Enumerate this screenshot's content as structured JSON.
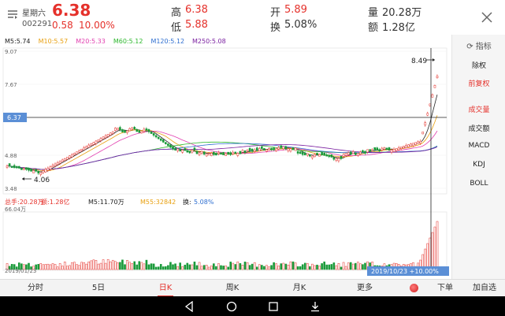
{
  "header": {
    "weekday": "星期六",
    "code": "002291",
    "price": "6.38",
    "change": "0.58",
    "change_pct": "10.00%",
    "high_label": "高",
    "high_value": "6.38",
    "low_label": "低",
    "low_value": "5.88",
    "open_label": "开",
    "open_value": "5.89",
    "turnover_label": "换",
    "turnover_value": "5.08%",
    "volume_label": "量",
    "volume_value": "20.28万",
    "amount_label": "额",
    "amount_value": "1.28亿"
  },
  "ma_legend": [
    {
      "text": "M5:5.74",
      "color": "#222222"
    },
    {
      "text": "M10:5.57",
      "color": "#e8a010"
    },
    {
      "text": "M20:5.33",
      "color": "#e23fb0"
    },
    {
      "text": "M60:5.12",
      "color": "#2eb82e"
    },
    {
      "text": "M120:5.12",
      "color": "#2f6fd0"
    },
    {
      "text": "M250:5.08",
      "color": "#7a1fa0"
    }
  ],
  "price_axis": {
    "top": "9.07",
    "second": "7.67",
    "mid": "6.37",
    "fourth": "4.88",
    "bottom": "3.48"
  },
  "annotations": {
    "high_label": "8.49",
    "low_label": "4.06"
  },
  "volume_legend": [
    {
      "text": "总手:20.28万",
      "color": "#e5312b"
    },
    {
      "text": "额:1.28亿",
      "color": "#e5312b"
    },
    {
      "text": "M5:11.70万",
      "color": "#222222"
    },
    {
      "text": "M55:32842",
      "color": "#e8a010"
    },
    {
      "text": "换:",
      "color": "#222222"
    },
    {
      "text": "5.08%",
      "color": "#2f6fd0"
    }
  ],
  "volume_axis_top": "66.04万",
  "x_axis": {
    "start_date": "2019/01/23",
    "cursor_label": "2019/10/23 +10.00%"
  },
  "sidebar": {
    "title": "指标",
    "items": [
      {
        "label": "除权",
        "active": false
      },
      {
        "label": "前复权",
        "active": true
      },
      {
        "label": "成交量",
        "active": true
      },
      {
        "label": "成交额",
        "active": false
      },
      {
        "label": "MACD",
        "active": false
      },
      {
        "label": "KDJ",
        "active": false
      },
      {
        "label": "BOLL",
        "active": false
      }
    ]
  },
  "tabs": [
    {
      "label": "分时",
      "active": false
    },
    {
      "label": "5日",
      "active": false
    },
    {
      "label": "日K",
      "active": true
    },
    {
      "label": "周K",
      "active": false
    },
    {
      "label": "月K",
      "active": false
    },
    {
      "label": "更多",
      "active": false
    },
    {
      "label": "下单",
      "active": false
    },
    {
      "label": "加自选",
      "active": false
    }
  ],
  "colors": {
    "up": "#e5312b",
    "down": "#1a9a3a",
    "accent": "#e5312b",
    "cursor_bg": "#5b8fd6"
  }
}
